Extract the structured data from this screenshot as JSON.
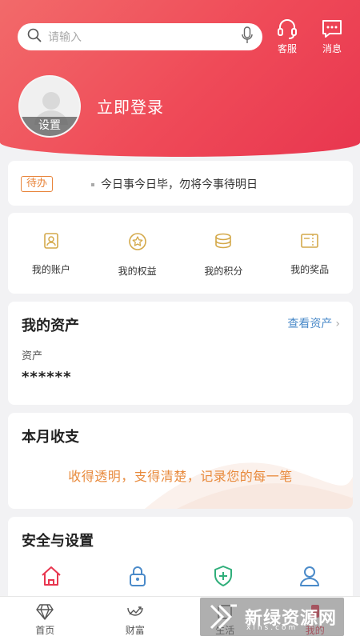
{
  "header": {
    "search_placeholder": "请输入",
    "service_label": "客服",
    "message_label": "消息",
    "avatar_label": "设置",
    "login_label": "立即登录"
  },
  "todo": {
    "tag": "待办",
    "text": "今日事今日毕，勿将今事待明日"
  },
  "quick": [
    {
      "label": "我的账户",
      "icon": "account-card-icon"
    },
    {
      "label": "我的权益",
      "icon": "rights-badge-icon"
    },
    {
      "label": "我的积分",
      "icon": "points-coins-icon"
    },
    {
      "label": "我的奖品",
      "icon": "prize-ticket-icon"
    }
  ],
  "assets": {
    "title": "我的资产",
    "link": "查看资产",
    "label": "资产",
    "value": "******"
  },
  "monthly": {
    "title": "本月收支",
    "slogan": "收得透明，支得清楚，记录您的每一笔"
  },
  "security": {
    "title": "安全与设置",
    "icons": [
      "home-icon",
      "lock-icon",
      "shield-plus-icon",
      "user-icon"
    ]
  },
  "tabs": [
    {
      "label": "首页",
      "icon": "diamond-icon"
    },
    {
      "label": "财富",
      "icon": "wealth-icon"
    },
    {
      "label": "生活",
      "icon": "life-icon"
    },
    {
      "label": "我的",
      "icon": "mine-icon",
      "active": true
    }
  ],
  "watermark": {
    "text": "新绿资源网",
    "sub": "xlhs.com"
  },
  "colors": {
    "brand": "#ef4a58",
    "accent_orange": "#e8843a",
    "link_blue": "#4a8ac9",
    "icon_gold": "#d4a94a"
  }
}
